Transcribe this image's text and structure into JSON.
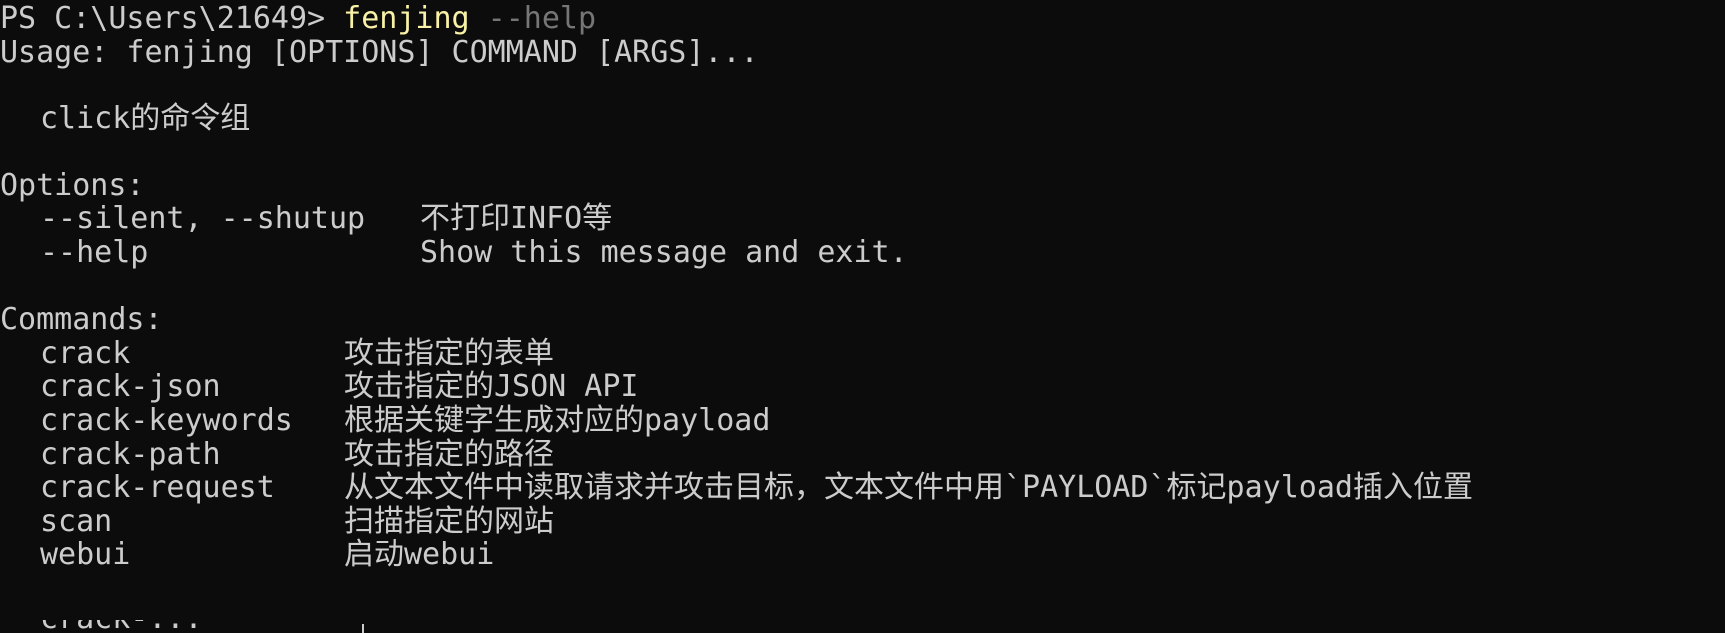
{
  "prompt": {
    "text": "PS C:\\Users\\21649> ",
    "command": "fenjing",
    "argument": " --help"
  },
  "usage": "Usage: fenjing [OPTIONS] COMMAND [ARGS]...",
  "description": "click的命令组",
  "options": {
    "heading": "Options:",
    "items": [
      {
        "flag": "--silent, --shutup",
        "desc": "不打印INFO等"
      },
      {
        "flag": "--help",
        "desc": "Show this message and exit."
      }
    ]
  },
  "commands": {
    "heading": "Commands:",
    "items": [
      {
        "name": "crack",
        "desc": "攻击指定的表单"
      },
      {
        "name": "crack-json",
        "desc": "攻击指定的JSON API"
      },
      {
        "name": "crack-keywords",
        "desc": "根据关键字生成对应的payload"
      },
      {
        "name": "crack-path",
        "desc": "攻击指定的路径"
      },
      {
        "name": "crack-request",
        "desc": "从文本文件中读取请求并攻击目标，文本文件中用`PAYLOAD`标记payload插入位置"
      },
      {
        "name": "scan",
        "desc": "扫描指定的网站"
      },
      {
        "name": "webui",
        "desc": "启动webui"
      }
    ],
    "partial_next": "crack-..."
  },
  "colors": {
    "background": "#0c0c0c",
    "text": "#cccccc",
    "command": "#f9f1a5",
    "argument": "#767676"
  }
}
